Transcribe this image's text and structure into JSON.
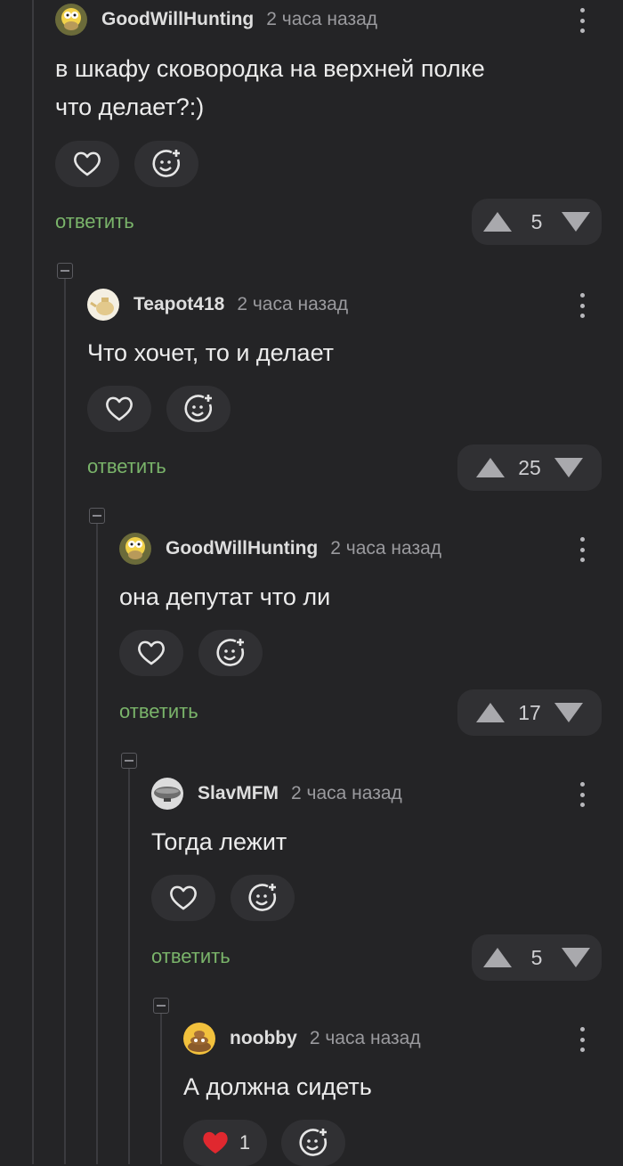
{
  "comments": [
    {
      "user": "GoodWillHunting",
      "time": "2 часа назад",
      "text": "в шкафу сковородка на верхней полке\nчто делает?:)",
      "reply": "ответить",
      "score": "5",
      "avatar": "homer-avatar"
    },
    {
      "user": "Teapot418",
      "time": "2 часа назад",
      "text": "Что хочет, то и делает",
      "reply": "ответить",
      "score": "25",
      "avatar": "teapot-avatar"
    },
    {
      "user": "GoodWillHunting",
      "time": "2 часа назад",
      "text": "она депутат что ли",
      "reply": "ответить",
      "score": "17",
      "avatar": "homer-avatar"
    },
    {
      "user": "SlavMFM",
      "time": "2 часа назад",
      "text": "Тогда лежит",
      "reply": "ответить",
      "score": "5",
      "avatar": "airship-avatar"
    },
    {
      "user": "noobby",
      "time": "2 часа назад",
      "text": "А должна сидеть",
      "like_count": "1",
      "avatar": "poop-avatar"
    }
  ],
  "colors": {
    "background": "#242426",
    "accent_reply": "#7ab46a",
    "liked_heart": "#e0282f"
  }
}
